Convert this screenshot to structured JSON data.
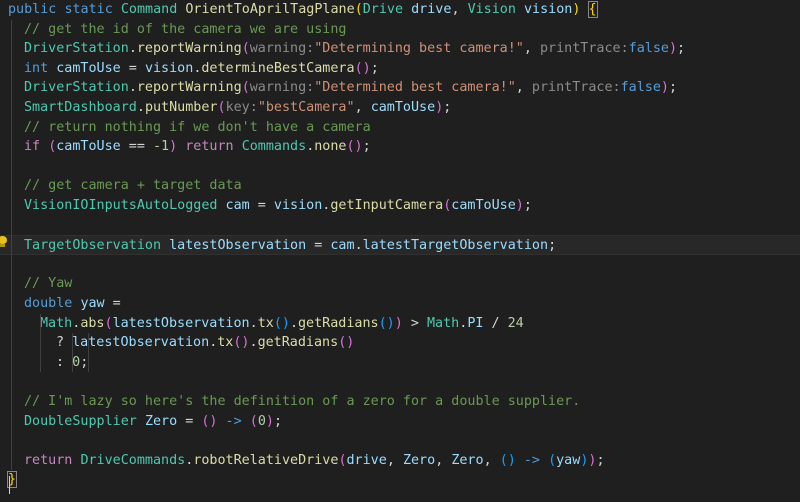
{
  "editor": {
    "theme": {
      "background": "#1f1f1f",
      "keyword": "#569cd6",
      "control": "#c586c0",
      "type": "#4ec9b0",
      "function": "#dcdcaa",
      "variable": "#9cdcfe",
      "string": "#ce9178",
      "number": "#b5cea8",
      "comment": "#6a9955",
      "plain": "#d4d4d4",
      "hint": "#8b8b8b",
      "bracket_gold": "#ffd700",
      "bracket_pink": "#da70d6",
      "bracket_blue": "#179fff",
      "warning_icon": "#e8c21d"
    },
    "lines": [
      {
        "indent": 0,
        "tokens": [
          [
            "public ",
            "keyword"
          ],
          [
            "static ",
            "keyword"
          ],
          [
            "Command ",
            "type"
          ],
          [
            "OrientToAprilTagPlane",
            "function"
          ],
          [
            "(",
            "bracket_gold"
          ],
          [
            "Drive ",
            "type"
          ],
          [
            "drive",
            "variable"
          ],
          [
            ", ",
            "plain"
          ],
          [
            "Vision ",
            "type"
          ],
          [
            "vision",
            "variable"
          ],
          [
            ")",
            "bracket_gold"
          ],
          [
            " ",
            "plain"
          ],
          [
            "{",
            "bracket_gold"
          ]
        ]
      },
      {
        "indent": 1,
        "tokens": [
          [
            "// get the id of the camera we are using",
            "comment"
          ]
        ]
      },
      {
        "indent": 1,
        "tokens": [
          [
            "DriverStation",
            "type"
          ],
          [
            ".",
            "plain"
          ],
          [
            "reportWarning",
            "function"
          ],
          [
            "(",
            "bracket_pink"
          ],
          [
            "warning:",
            "hint"
          ],
          [
            "\"Determining best camera!\"",
            "string"
          ],
          [
            ", ",
            "plain"
          ],
          [
            "printTrace:",
            "hint"
          ],
          [
            "false",
            "keyword"
          ],
          [
            ")",
            "bracket_pink"
          ],
          [
            ";",
            "plain"
          ]
        ]
      },
      {
        "indent": 1,
        "tokens": [
          [
            "int ",
            "keyword"
          ],
          [
            "camToUse",
            "variable"
          ],
          [
            " = ",
            "plain"
          ],
          [
            "vision",
            "variable"
          ],
          [
            ".",
            "plain"
          ],
          [
            "determineBestCamera",
            "function"
          ],
          [
            "()",
            "bracket_pink"
          ],
          [
            ";",
            "plain"
          ]
        ]
      },
      {
        "indent": 1,
        "tokens": [
          [
            "DriverStation",
            "type"
          ],
          [
            ".",
            "plain"
          ],
          [
            "reportWarning",
            "function"
          ],
          [
            "(",
            "bracket_pink"
          ],
          [
            "warning:",
            "hint"
          ],
          [
            "\"Determined best camera!\"",
            "string"
          ],
          [
            ", ",
            "plain"
          ],
          [
            "printTrace:",
            "hint"
          ],
          [
            "false",
            "keyword"
          ],
          [
            ")",
            "bracket_pink"
          ],
          [
            ";",
            "plain"
          ]
        ]
      },
      {
        "indent": 1,
        "tokens": [
          [
            "SmartDashboard",
            "type"
          ],
          [
            ".",
            "plain"
          ],
          [
            "putNumber",
            "function"
          ],
          [
            "(",
            "bracket_pink"
          ],
          [
            "key:",
            "hint"
          ],
          [
            "\"bestCamera\"",
            "string"
          ],
          [
            ", ",
            "plain"
          ],
          [
            "camToUse",
            "variable"
          ],
          [
            ")",
            "bracket_pink"
          ],
          [
            ";",
            "plain"
          ]
        ]
      },
      {
        "indent": 1,
        "tokens": [
          [
            "// return nothing if we don't have a camera",
            "comment"
          ]
        ]
      },
      {
        "indent": 1,
        "tokens": [
          [
            "if ",
            "control"
          ],
          [
            "(",
            "bracket_pink"
          ],
          [
            "camToUse",
            "variable"
          ],
          [
            " == ",
            "plain"
          ],
          [
            "-1",
            "number"
          ],
          [
            ")",
            "bracket_pink"
          ],
          [
            " ",
            "plain"
          ],
          [
            "return ",
            "control"
          ],
          [
            "Commands",
            "type"
          ],
          [
            ".",
            "plain"
          ],
          [
            "none",
            "function"
          ],
          [
            "()",
            "bracket_pink"
          ],
          [
            ";",
            "plain"
          ]
        ]
      },
      {
        "indent": 0,
        "tokens": []
      },
      {
        "indent": 1,
        "tokens": [
          [
            "// get camera + target data",
            "comment"
          ]
        ]
      },
      {
        "indent": 1,
        "tokens": [
          [
            "VisionIOInputsAutoLogged ",
            "type"
          ],
          [
            "cam",
            "variable"
          ],
          [
            " = ",
            "plain"
          ],
          [
            "vision",
            "variable"
          ],
          [
            ".",
            "plain"
          ],
          [
            "getInputCamera",
            "function"
          ],
          [
            "(",
            "bracket_pink"
          ],
          [
            "camToUse",
            "variable"
          ],
          [
            ")",
            "bracket_pink"
          ],
          [
            ";",
            "plain"
          ]
        ]
      },
      {
        "indent": 0,
        "tokens": []
      },
      {
        "indent": 1,
        "current": true,
        "tokens": [
          [
            "TargetObservation ",
            "type"
          ],
          [
            "latestObservation",
            "variable"
          ],
          [
            " = ",
            "plain"
          ],
          [
            "cam",
            "variable"
          ],
          [
            ".",
            "plain"
          ],
          [
            "latestTargetObservation",
            "variable"
          ],
          [
            ";",
            "plain"
          ]
        ]
      },
      {
        "indent": 0,
        "tokens": []
      },
      {
        "indent": 1,
        "tokens": [
          [
            "// Yaw",
            "comment"
          ]
        ]
      },
      {
        "indent": 1,
        "tokens": [
          [
            "double ",
            "keyword"
          ],
          [
            "yaw",
            "variable"
          ],
          [
            " =",
            "plain"
          ]
        ]
      },
      {
        "indent": 2,
        "tokens": [
          [
            "Math",
            "type"
          ],
          [
            ".",
            "plain"
          ],
          [
            "abs",
            "function"
          ],
          [
            "(",
            "bracket_pink"
          ],
          [
            "latestObservation",
            "variable"
          ],
          [
            ".",
            "plain"
          ],
          [
            "tx",
            "function"
          ],
          [
            "()",
            "bracket_blue"
          ],
          [
            ".",
            "plain"
          ],
          [
            "getRadians",
            "function"
          ],
          [
            "()",
            "bracket_blue"
          ],
          [
            ")",
            "bracket_pink"
          ],
          [
            " > ",
            "plain"
          ],
          [
            "Math",
            "type"
          ],
          [
            ".",
            "plain"
          ],
          [
            "PI",
            "variable"
          ],
          [
            " / ",
            "plain"
          ],
          [
            "24",
            "number"
          ]
        ]
      },
      {
        "indent": 3,
        "tokens": [
          [
            "? ",
            "plain"
          ],
          [
            "latestObservation",
            "variable"
          ],
          [
            ".",
            "plain"
          ],
          [
            "tx",
            "function"
          ],
          [
            "()",
            "bracket_pink"
          ],
          [
            ".",
            "plain"
          ],
          [
            "getRadians",
            "function"
          ],
          [
            "()",
            "bracket_pink"
          ]
        ]
      },
      {
        "indent": 3,
        "tokens": [
          [
            ": ",
            "plain"
          ],
          [
            "0",
            "number"
          ],
          [
            ";",
            "plain"
          ]
        ]
      },
      {
        "indent": 0,
        "tokens": []
      },
      {
        "indent": 1,
        "tokens": [
          [
            "// I'm lazy so here's the definition of a zero for a double supplier.",
            "comment"
          ]
        ]
      },
      {
        "indent": 1,
        "tokens": [
          [
            "DoubleSupplier ",
            "type"
          ],
          [
            "Zero",
            "variable"
          ],
          [
            " = ",
            "plain"
          ],
          [
            "()",
            "bracket_pink"
          ],
          [
            " -> ",
            "keyword"
          ],
          [
            "(",
            "bracket_pink"
          ],
          [
            "0",
            "number"
          ],
          [
            ")",
            "bracket_pink"
          ],
          [
            ";",
            "plain"
          ]
        ]
      },
      {
        "indent": 0,
        "tokens": []
      },
      {
        "indent": 1,
        "tokens": [
          [
            "return ",
            "control"
          ],
          [
            "DriveCommands",
            "type"
          ],
          [
            ".",
            "plain"
          ],
          [
            "robotRelativeDrive",
            "function"
          ],
          [
            "(",
            "bracket_pink"
          ],
          [
            "drive",
            "variable"
          ],
          [
            ", ",
            "plain"
          ],
          [
            "Zero",
            "variable"
          ],
          [
            ", ",
            "plain"
          ],
          [
            "Zero",
            "variable"
          ],
          [
            ", ",
            "plain"
          ],
          [
            "()",
            "bracket_blue"
          ],
          [
            " -> ",
            "keyword"
          ],
          [
            "(",
            "bracket_blue"
          ],
          [
            "yaw",
            "variable"
          ],
          [
            ")",
            "bracket_blue"
          ],
          [
            ")",
            "bracket_pink"
          ],
          [
            ";",
            "plain"
          ]
        ]
      },
      {
        "indent": 0,
        "tokens": [
          [
            "}",
            "bracket_gold"
          ]
        ]
      }
    ]
  }
}
